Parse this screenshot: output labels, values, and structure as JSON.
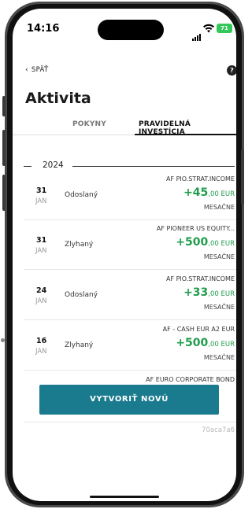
{
  "status_bar": {
    "time": "14:16",
    "battery": "71"
  },
  "nav": {
    "back_label": "SPÄŤ",
    "help_label": "?"
  },
  "page": {
    "title": "Aktivita"
  },
  "tabs": [
    {
      "label": "POKYNY",
      "active": false
    },
    {
      "label": "PRAVIDELNÁ INVESTÍCIA",
      "active": true
    }
  ],
  "year": "2024",
  "transactions": [
    {
      "day": "31",
      "month": "JAN",
      "status": "Odoslaný",
      "fund": "AF PIO.STRAT.INCOME",
      "amount_main": "+45",
      "amount_rest": ",00 EUR",
      "frequency": "MESAČNE"
    },
    {
      "day": "31",
      "month": "JAN",
      "status": "Zlyhaný",
      "fund": "AF PIONEER US EQUITY...",
      "amount_main": "+500",
      "amount_rest": ",00 EUR",
      "frequency": "MESAČNE"
    },
    {
      "day": "24",
      "month": "JAN",
      "status": "Odoslaný",
      "fund": "AF PIO.STRAT.INCOME",
      "amount_main": "+33",
      "amount_rest": ",00 EUR",
      "frequency": "MESAČNE"
    },
    {
      "day": "16",
      "month": "JAN",
      "status": "Zlyhaný",
      "fund": "AF - CASH EUR A2 EUR",
      "amount_main": "+500",
      "amount_rest": ",00 EUR",
      "frequency": "MESAČNE"
    },
    {
      "day": "",
      "month": "",
      "status": "",
      "fund": "AF EURO CORPORATE BOND",
      "amount_main": "",
      "amount_rest": "",
      "frequency": ""
    }
  ],
  "cta": {
    "label": "VYTVORIŤ NOVÚ"
  },
  "footer": {
    "hash": "70aca7a6"
  },
  "colors": {
    "accent": "#1a7a8e",
    "positive": "#1f9d4d",
    "battery": "#34c759"
  }
}
